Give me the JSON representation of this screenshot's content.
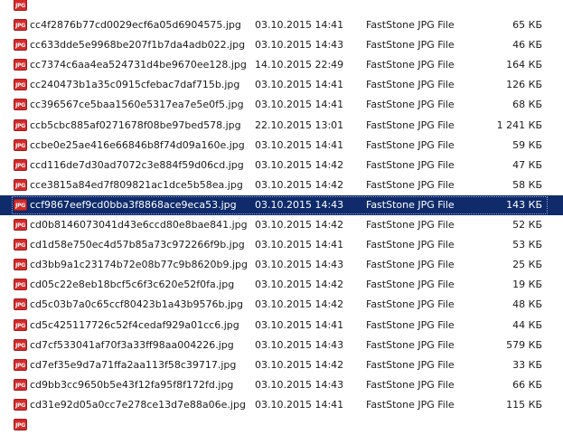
{
  "file_type_label": "FastStone JPG File",
  "icon_text": "JPG",
  "selected_index": 10,
  "files": [
    {
      "name": "",
      "date": "",
      "type": "",
      "size": ""
    },
    {
      "name": "cc4f2876b77cd0029ecf6a05d6904575.jpg",
      "date": "03.10.2015 14:41",
      "type": "FastStone JPG File",
      "size": "65 КБ"
    },
    {
      "name": "cc633dde5e9968be207f1b7da4adb022.jpg",
      "date": "03.10.2015 14:43",
      "type": "FastStone JPG File",
      "size": "46 КБ"
    },
    {
      "name": "cc7374c6aa4ea524731d4be9670ee128.jpg",
      "date": "14.10.2015 22:49",
      "type": "FastStone JPG File",
      "size": "164 КБ"
    },
    {
      "name": "cc240473b1a35c0915cfebac7daf715b.jpg",
      "date": "03.10.2015 14:41",
      "type": "FastStone JPG File",
      "size": "126 КБ"
    },
    {
      "name": "cc396567ce5baa1560e5317ea7e5e0f5.jpg",
      "date": "03.10.2015 14:41",
      "type": "FastStone JPG File",
      "size": "68 КБ"
    },
    {
      "name": "ccb5cbc885af0271678f08be97bed578.jpg",
      "date": "22.10.2015 13:01",
      "type": "FastStone JPG File",
      "size": "1 241 КБ"
    },
    {
      "name": "ccbe0e25ae416e66846b8f74d09a160e.jpg",
      "date": "03.10.2015 14:41",
      "type": "FastStone JPG File",
      "size": "59 КБ"
    },
    {
      "name": "ccd116de7d30ad7072c3e884f59d06cd.jpg",
      "date": "03.10.2015 14:42",
      "type": "FastStone JPG File",
      "size": "47 КБ"
    },
    {
      "name": "cce3815a84ed7f809821ac1dce5b58ea.jpg",
      "date": "03.10.2015 14:42",
      "type": "FastStone JPG File",
      "size": "58 КБ"
    },
    {
      "name": "ccf9867eef9cd0bba3f8868ace9eca53.jpg",
      "date": "03.10.2015 14:43",
      "type": "FastStone JPG File",
      "size": "143 КБ"
    },
    {
      "name": "cd0b8146073041d43e6ccd80e8bae841.jpg",
      "date": "03.10.2015 14:42",
      "type": "FastStone JPG File",
      "size": "52 КБ"
    },
    {
      "name": "cd1d58e750ec4d57b85a73c972266f9b.jpg",
      "date": "03.10.2015 14:41",
      "type": "FastStone JPG File",
      "size": "53 КБ"
    },
    {
      "name": "cd3bb9a1c23174b72e08b77c9b8620b9.jpg",
      "date": "03.10.2015 14:43",
      "type": "FastStone JPG File",
      "size": "25 КБ"
    },
    {
      "name": "cd05c22e8eb18bcf5c6f3c620e52f0fa.jpg",
      "date": "03.10.2015 14:42",
      "type": "FastStone JPG File",
      "size": "19 КБ"
    },
    {
      "name": "cd5c03b7a0c65ccf80423b1a43b9576b.jpg",
      "date": "03.10.2015 14:42",
      "type": "FastStone JPG File",
      "size": "48 КБ"
    },
    {
      "name": "cd5c425117726c52f4cedaf929a01cc6.jpg",
      "date": "03.10.2015 14:41",
      "type": "FastStone JPG File",
      "size": "44 КБ"
    },
    {
      "name": "cd7cf533041af70f3a33ff98aa004226.jpg",
      "date": "03.10.2015 14:43",
      "type": "FastStone JPG File",
      "size": "579 КБ"
    },
    {
      "name": "cd7ef35e9d7a71ffa2aa113f58c39717.jpg",
      "date": "03.10.2015 14:42",
      "type": "FastStone JPG File",
      "size": "33 КБ"
    },
    {
      "name": "cd9bb3cc9650b5e43f12fa95f8f172fd.jpg",
      "date": "03.10.2015 14:43",
      "type": "FastStone JPG File",
      "size": "66 КБ"
    },
    {
      "name": "cd31e92d05a0cc7e278ce13d7e88a06e.jpg",
      "date": "03.10.2015 14:41",
      "type": "FastStone JPG File",
      "size": "115 КБ"
    },
    {
      "name": "",
      "date": "",
      "type": "",
      "size": ""
    }
  ]
}
